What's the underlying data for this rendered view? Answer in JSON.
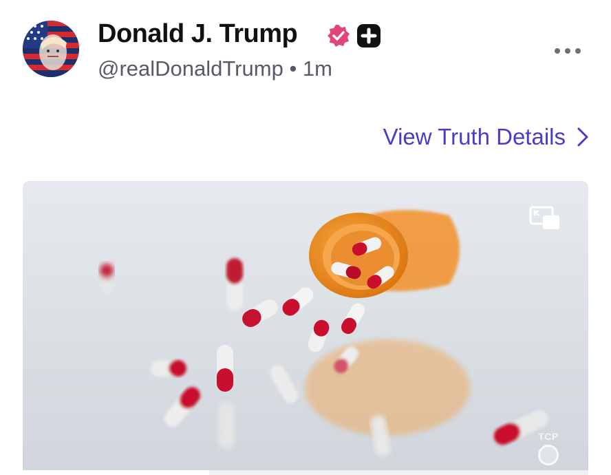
{
  "post": {
    "author_name": "Donald J. Trump",
    "handle": "@realDonaldTrump",
    "separator": "•",
    "time": "1m",
    "verified": true,
    "badge_icons": [
      "verified-badge-icon",
      "plus-badge-icon"
    ],
    "more_icon": "more-horizontal-icon"
  },
  "details_link": {
    "label": "View Truth Details",
    "icon": "chevron-right-icon"
  },
  "media": {
    "pip_icon": "picture-in-picture-icon",
    "watermark": "TCP",
    "progress": 0.33
  },
  "colors": {
    "link": "#4b3cc4",
    "verified_badge": "#e0457b",
    "pill_red": "#c8102e",
    "bottle_orange": "#f08a1c"
  }
}
